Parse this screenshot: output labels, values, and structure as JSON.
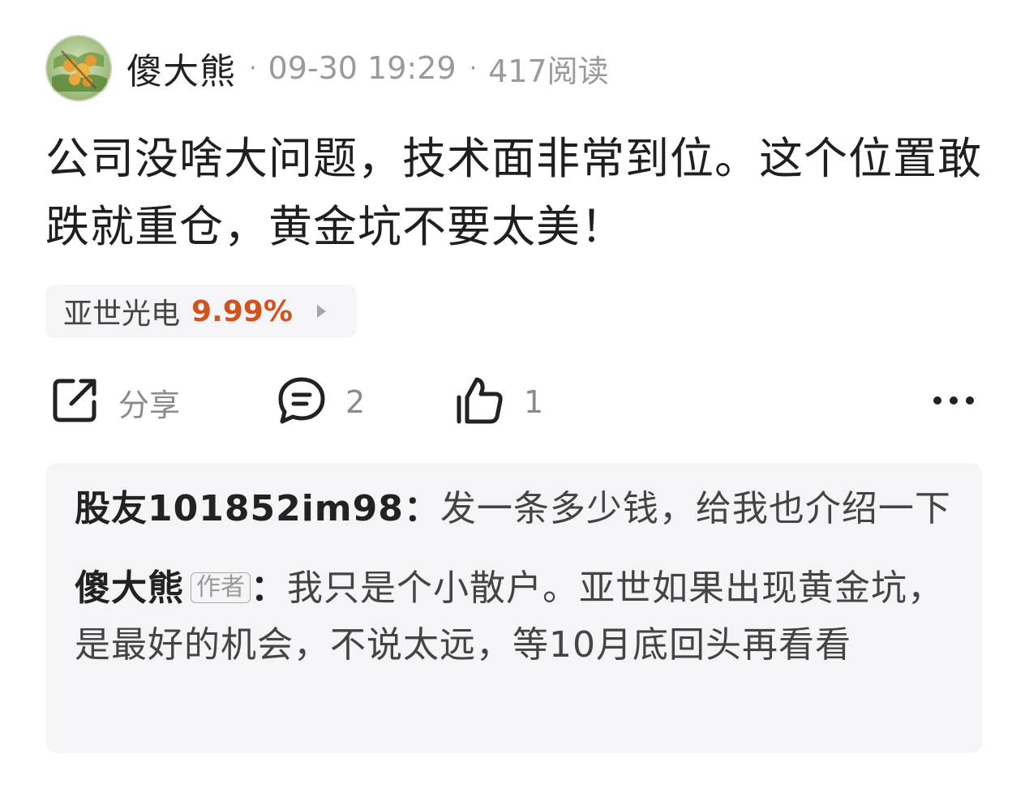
{
  "post": {
    "author": "傻大熊",
    "date": "09-30 19:29",
    "reads": "417阅读",
    "separator": "·",
    "content": "公司没啥大问题，技术面非常到位。这个位置敢跌就重仓，黄金坑不要太美！"
  },
  "stock": {
    "name": "亚世光电",
    "change": "9.99%",
    "change_color": "#d0541f"
  },
  "actions": {
    "share_label": "分享",
    "comment_count": "2",
    "like_count": "1",
    "icons": [
      "share-icon",
      "comment-icon",
      "thumbs-up-icon",
      "more-icon"
    ]
  },
  "comments": [
    {
      "user": "股友101852im98",
      "colon": "：",
      "text": "发一条多少钱，给我也介绍一下"
    },
    {
      "user": "傻大熊",
      "badge": "作者",
      "colon": "：",
      "text": "我只是个小散户。亚世如果出现黄金坑，是最好的机会，不说太远，等10月底回头再看看"
    }
  ]
}
